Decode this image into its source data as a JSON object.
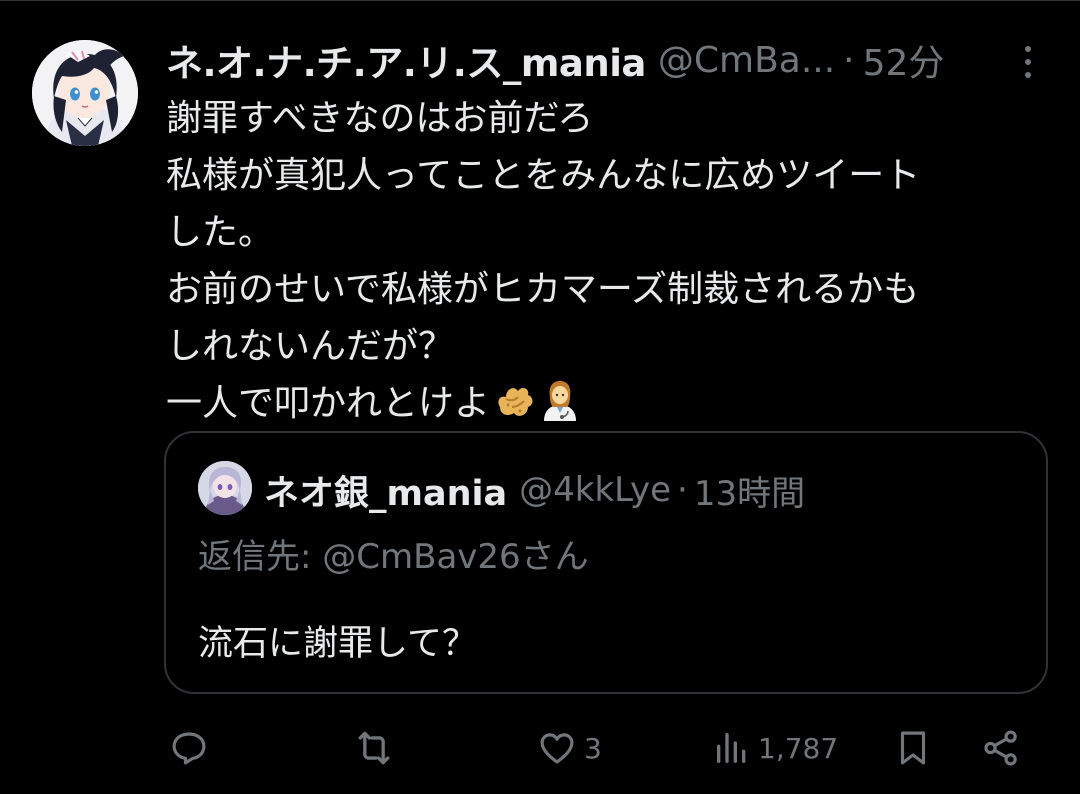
{
  "tweet": {
    "display_name": "ネ.オ.ナ.チ.ア.リ.ス_mania",
    "handle": "@CmBa...",
    "separator": "·",
    "time": "52分",
    "avatar_icon": "anime-girl-avatar",
    "body_lines": [
      "謝罪すべきなのはお前だろ",
      "私様が真犯人ってことをみんなに広めツイート",
      "した。",
      "お前のせいで私様がヒカマーズ制裁されるかも",
      "しれないんだが？",
      "一人で叩かれとけよ"
    ],
    "emojis": [
      "ginger-emoji",
      "woman-health-worker-emoji"
    ]
  },
  "quote": {
    "display_name": "ネオ銀_mania",
    "handle": "@4kkLye",
    "separator": "·",
    "time": "13時間",
    "reply_to": "返信先: @CmBav26さん",
    "text": "流石に謝罪して？",
    "avatar_icon": "anime-character-avatar"
  },
  "actions": {
    "reply": {
      "icon": "reply-icon",
      "count": ""
    },
    "retweet": {
      "icon": "retweet-icon",
      "count": ""
    },
    "like": {
      "icon": "heart-icon",
      "count": "3"
    },
    "views": {
      "icon": "views-icon",
      "count": "1,787"
    },
    "bookmark": {
      "icon": "bookmark-icon",
      "count": ""
    },
    "share": {
      "icon": "share-icon",
      "count": ""
    }
  },
  "colors": {
    "background": "#000000",
    "text_primary": "#e7e9ea",
    "text_secondary": "#71767b",
    "border": "#2f3336"
  }
}
